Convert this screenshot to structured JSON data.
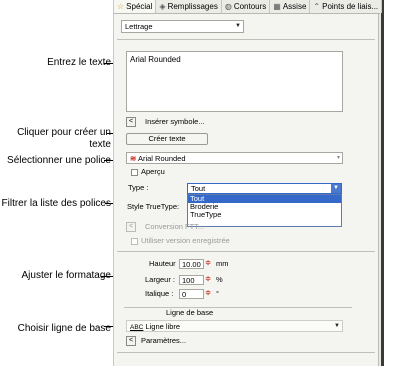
{
  "tabs": [
    {
      "icon": "star-icon",
      "glyph": "☆",
      "label": "Spécial"
    },
    {
      "icon": "fill-icon",
      "glyph": "◈",
      "label": "Remplissages"
    },
    {
      "icon": "outline-icon",
      "glyph": "◍",
      "label": "Contours"
    },
    {
      "icon": "underlay-icon",
      "glyph": "▦",
      "label": "Assise"
    },
    {
      "icon": "points-icon",
      "glyph": "⌃",
      "label": "Points de liais..."
    }
  ],
  "type_select": {
    "value": "Lettrage"
  },
  "text_area": {
    "value": "Arial Rounded"
  },
  "insert_symbol": {
    "button": "<",
    "label": "Insérer symbole..."
  },
  "create_text_button": "Créer texte",
  "font_select": {
    "icon": "≋",
    "value": "Arial Rounded"
  },
  "preview": {
    "label": "Aperçu"
  },
  "type_filter": {
    "label": "Type :",
    "value": "Tout",
    "options": [
      "Tout",
      "Broderie",
      "TrueType"
    ]
  },
  "truetype_style": {
    "label": "Style TrueType:"
  },
  "ftt_conversion": {
    "button": "<",
    "label": "Conversion FTT..."
  },
  "saved_version": {
    "label": "Utiliser version enregistrée"
  },
  "height": {
    "label": "Hauteur",
    "value": "10.00",
    "unit": "mm"
  },
  "width": {
    "label": "Largeur :",
    "value": "100",
    "unit": "%"
  },
  "italic": {
    "label": "Italique :",
    "value": "0",
    "unit": "°"
  },
  "baseline": {
    "section_label": "Ligne de base",
    "icon": "ABC",
    "value": "Ligne libre",
    "params_button": "<",
    "params_label": "Paramètres..."
  },
  "annotations": {
    "enter_text": "Entrez le texte",
    "create_text": "Cliquer pour créer un texte",
    "select_font": "Sélectionner une police",
    "filter_fonts": "Filtrer la liste des polices",
    "adjust_format": "Ajuster le formatage",
    "choose_baseline": "Choisir ligne de base"
  }
}
